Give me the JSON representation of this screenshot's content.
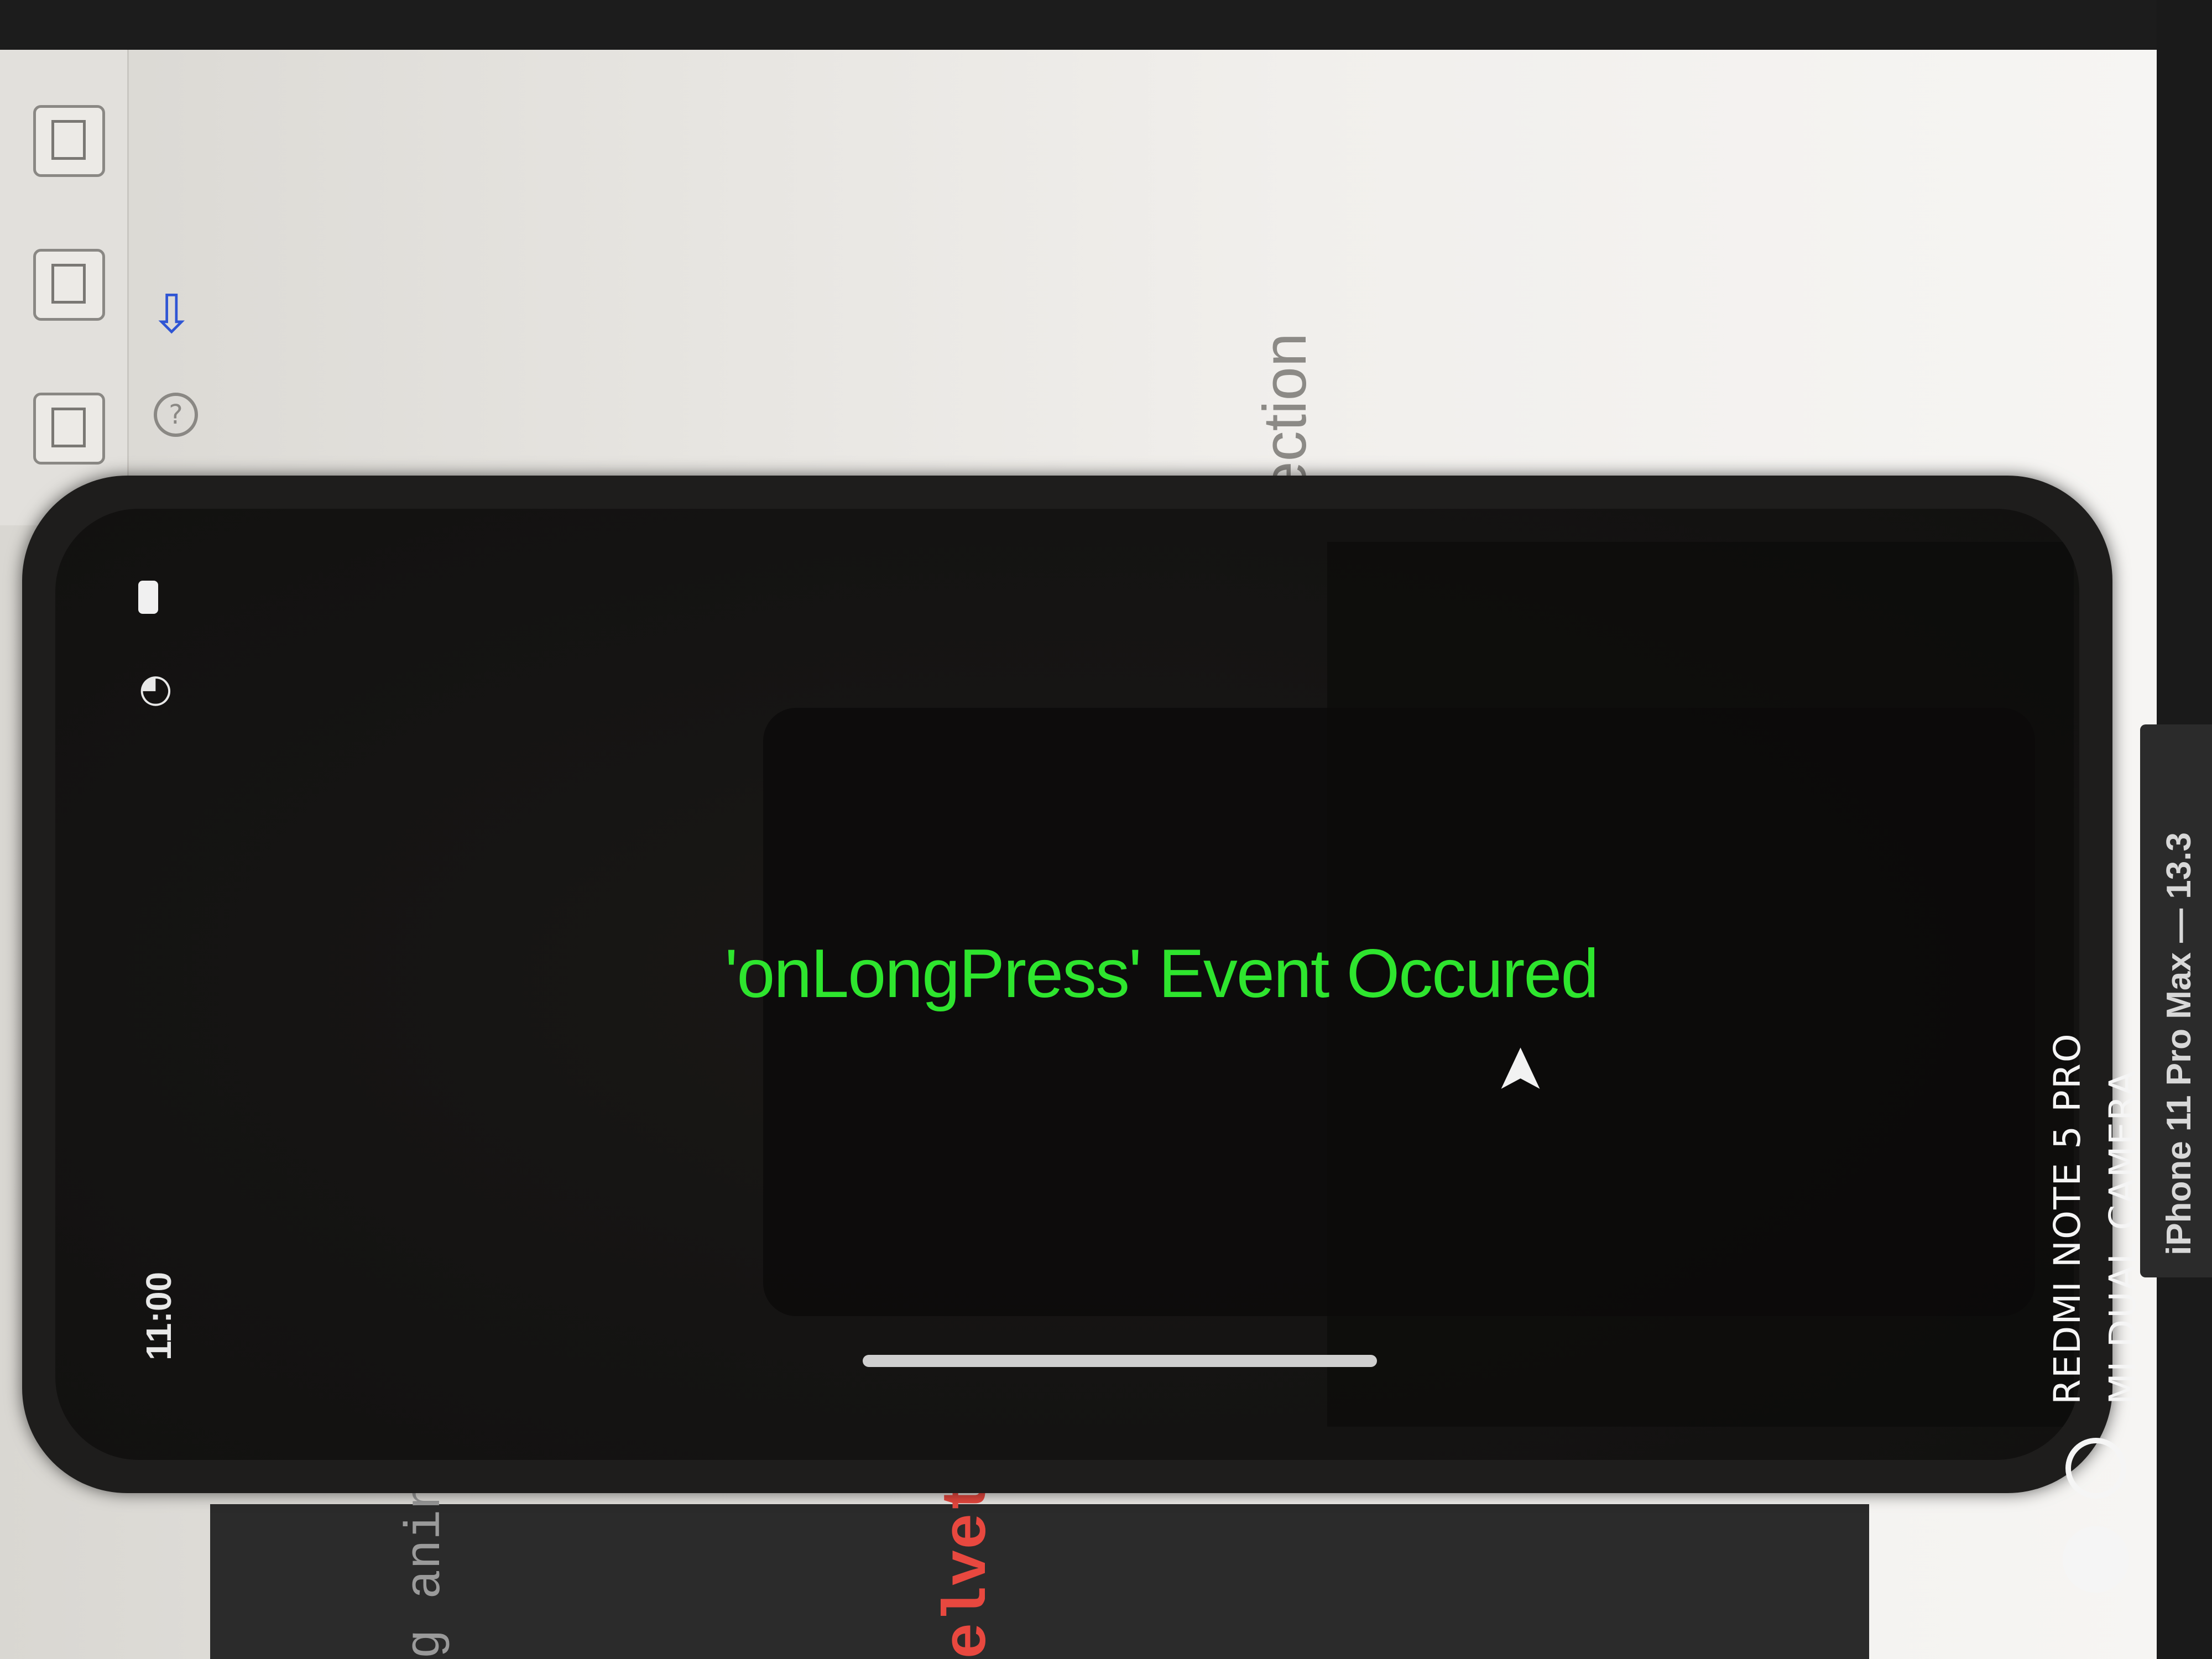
{
  "background_editor": {
    "partial_heading": "lection",
    "code_fragment_1": "g anin",
    "code_fragment_2": "elvetic"
  },
  "simulator": {
    "status_bar": {
      "time": "11:00",
      "wifi_icon": "wifi-icon",
      "battery_icon": "battery-icon"
    },
    "event_message": "'onLongPress' Event Occured",
    "event_message_color": "#2ee52e",
    "cursor_icon": "mouse-pointer-icon",
    "device_label": "iPhone 11 Pro Max — 13.3"
  },
  "camera_watermark": {
    "line1": "REDMI NOTE 5 PRO",
    "line2": "MI DUAL CAMERA"
  }
}
